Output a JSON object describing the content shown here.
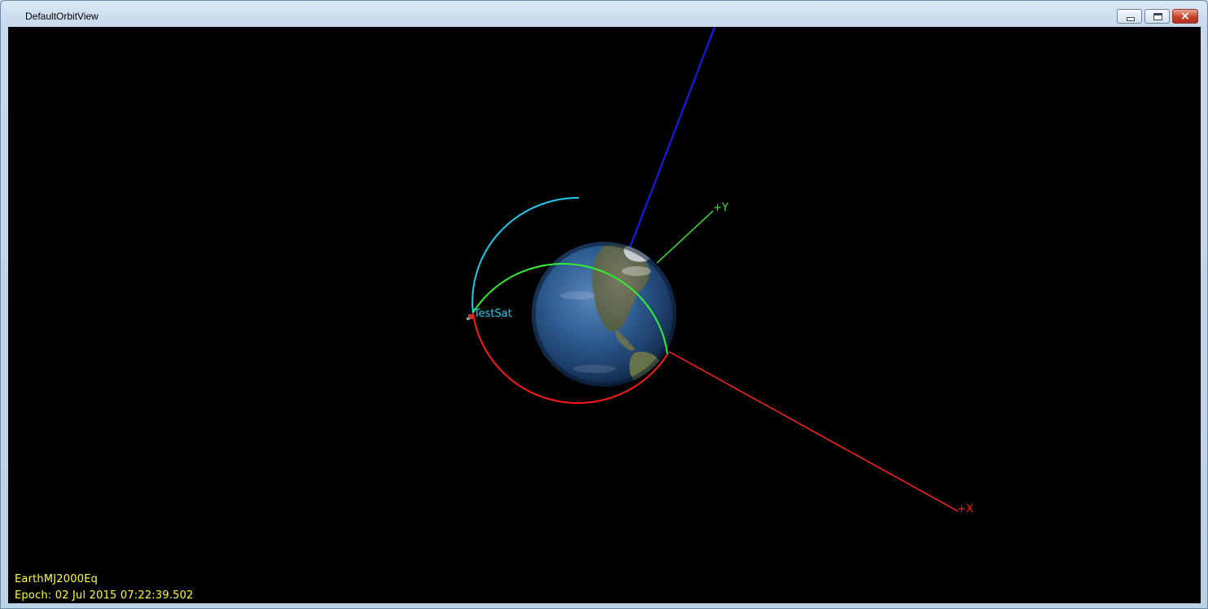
{
  "window": {
    "title": "DefaultOrbitView",
    "buttons": {
      "minimize": "minimize-icon",
      "maximize": "maximize-icon",
      "close": "close-icon"
    }
  },
  "view": {
    "background": "#000000",
    "spacecraft_label": "TestSat",
    "axes": {
      "x_label": "+X",
      "y_label": "+Y",
      "x_color": "#ff2020",
      "y_color": "#33ee33",
      "z_color": "#1a1aff"
    },
    "orbit_colors": {
      "current": "#ff1a1a",
      "leading": "#33ee33",
      "trailing": "#22ccee"
    }
  },
  "status": {
    "coordinate_system": "EarthMJ2000Eq",
    "epoch_prefix": "Epoch:",
    "epoch_value": "02 Jul 2015 07:22:39.502"
  }
}
